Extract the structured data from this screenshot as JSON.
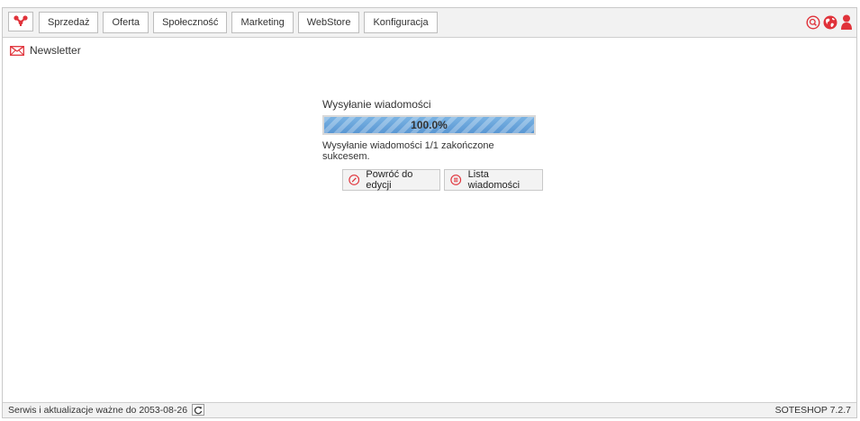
{
  "colors": {
    "accent": "#e0323a",
    "progress": "#5a97d3"
  },
  "topbar": {
    "logo_icon": "share-nodes-icon",
    "nav": [
      {
        "label": "Sprzedaż"
      },
      {
        "label": "Oferta"
      },
      {
        "label": "Społeczność"
      },
      {
        "label": "Marketing"
      },
      {
        "label": "WebStore"
      },
      {
        "label": "Konfiguracja"
      }
    ],
    "icons": [
      "search-icon",
      "globe-icon",
      "user-icon"
    ]
  },
  "page": {
    "title": "Newsletter",
    "title_icon": "envelope-icon"
  },
  "sending": {
    "title": "Wysyłanie wiadomości",
    "progress_percent": 100.0,
    "progress_label": "100.0%",
    "message": "Wysyłanie wiadomości 1/1 zakończone sukcesem.",
    "back_label": "Powróć do edycji",
    "list_label": "Lista wiadomości"
  },
  "footer": {
    "service_text": "Serwis i aktualizacje ważne do 2053-08-26",
    "version": "SOTESHOP 7.2.7"
  }
}
